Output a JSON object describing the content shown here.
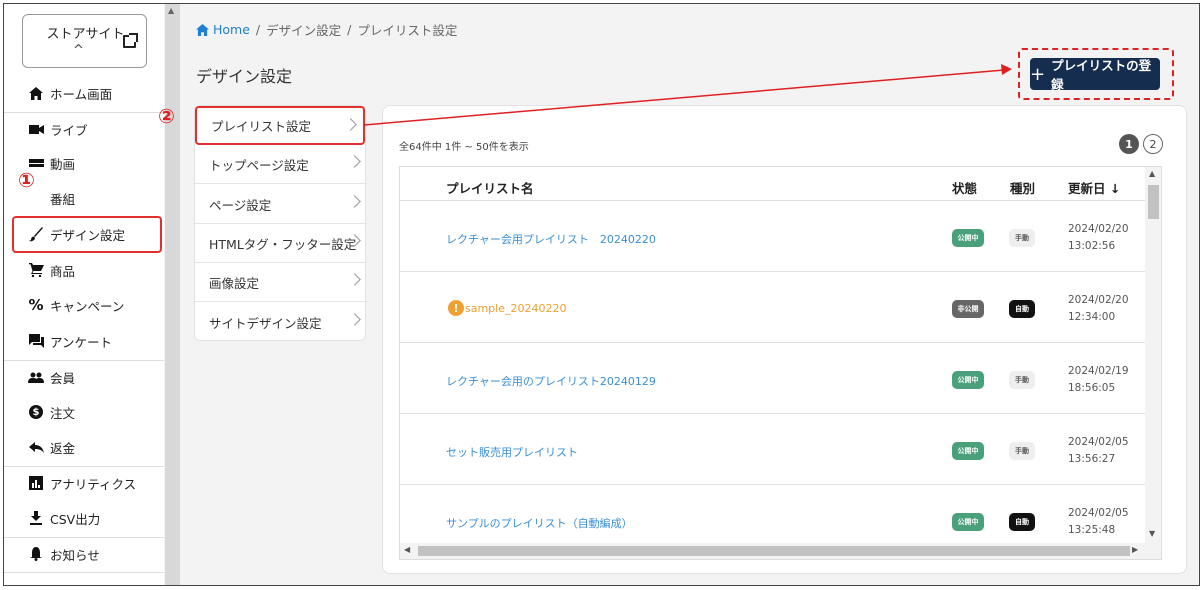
{
  "sidebar": {
    "store_site": "ストアサイト",
    "items": [
      {
        "label": "ホーム画面",
        "icon": "home-icon"
      },
      {
        "label": "ライブ",
        "icon": "video-camera-icon"
      },
      {
        "label": "動画",
        "icon": "clapperboard-icon"
      },
      {
        "label": "番組",
        "icon": "program-icon"
      },
      {
        "label": "デザイン設定",
        "icon": "brush-icon"
      },
      {
        "label": "商品",
        "icon": "cart-icon"
      },
      {
        "label": "キャンペーン",
        "icon": "percent-icon"
      },
      {
        "label": "アンケート",
        "icon": "chat-icon"
      },
      {
        "label": "会員",
        "icon": "members-icon"
      },
      {
        "label": "注文",
        "icon": "dollar-icon"
      },
      {
        "label": "返金",
        "icon": "reply-icon"
      },
      {
        "label": "アナリティクス",
        "icon": "analytics-icon"
      },
      {
        "label": "CSV出力",
        "icon": "download-icon"
      },
      {
        "label": "お知らせ",
        "icon": "bell-icon"
      }
    ]
  },
  "annotations": {
    "step1": "①",
    "step2": "②"
  },
  "breadcrumb": {
    "home": "Home",
    "level1": "デザイン設定",
    "level2": "プレイリスト設定",
    "sep": "/"
  },
  "page_title": "デザイン設定",
  "add_button": {
    "plus": "+",
    "label": "プレイリストの登録"
  },
  "submenu": [
    {
      "label": "プレイリスト設定"
    },
    {
      "label": "トップページ設定"
    },
    {
      "label": "ページ設定"
    },
    {
      "label": "HTMLタグ・フッター設定"
    },
    {
      "label": "画像設定"
    },
    {
      "label": "サイトデザイン設定"
    }
  ],
  "table": {
    "count_text": "全64件中 1件 ~ 50件を表示",
    "pages": [
      "1",
      "2"
    ],
    "headers": {
      "name": "プレイリスト名",
      "status": "状態",
      "type": "種別",
      "updated": "更新日 ↓"
    },
    "rows": [
      {
        "name": "レクチャー会用プレイリスト　20240220",
        "status": "公開中",
        "type": "手動",
        "date": "2024/02/20",
        "time": "13:02:56",
        "warn": false
      },
      {
        "name": "sample_20240220",
        "status": "非公開",
        "type": "自動",
        "date": "2024/02/20",
        "time": "12:34:00",
        "warn": true
      },
      {
        "name": "レクチャー会用のプレイリスト20240129",
        "status": "公開中",
        "type": "手動",
        "date": "2024/02/19",
        "time": "18:56:05",
        "warn": false
      },
      {
        "name": "セット販売用プレイリスト",
        "status": "公開中",
        "type": "手動",
        "date": "2024/02/05",
        "time": "13:56:27",
        "warn": false
      },
      {
        "name": "サンプルのプレイリスト（自動編成）",
        "status": "公開中",
        "type": "自動",
        "date": "2024/02/05",
        "time": "13:25:48",
        "warn": false
      }
    ]
  }
}
